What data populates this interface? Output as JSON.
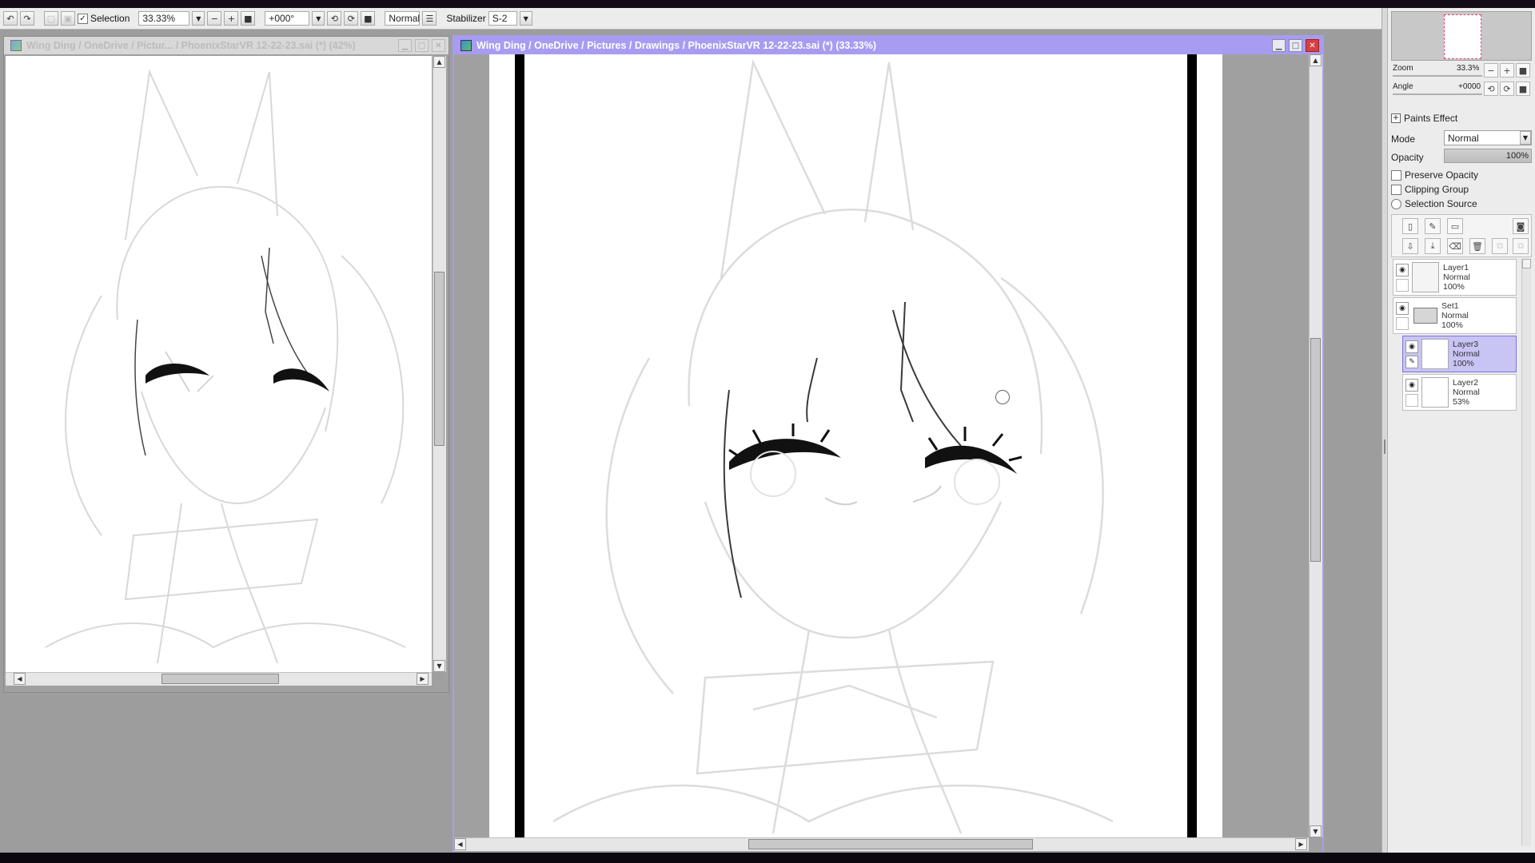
{
  "toolbar": {
    "selection_label": "Selection",
    "selection_checked": "✓",
    "zoom_value": "33.33%",
    "angle_value": "+000°",
    "blend_mode": "Normal",
    "stabilizer_label": "Stabilizer",
    "stabilizer_value": "S-2"
  },
  "windows": {
    "left": {
      "title": "Wing Ding / OneDrive / Pictur... / PhoenixStarVR 12-22-23.sai (*) (42%)"
    },
    "main": {
      "title": "Wing Ding / OneDrive / Pictures / Drawings / PhoenixStarVR 12-22-23.sai (*) (33.33%)"
    }
  },
  "navigator": {
    "zoom_label": "Zoom",
    "zoom_value": "33.3%",
    "angle_label": "Angle",
    "angle_value": "+0000"
  },
  "layer_props": {
    "paints_effect_label": "Paints Effect",
    "mode_label": "Mode",
    "mode_value": "Normal",
    "opacity_label": "Opacity",
    "opacity_value": "100%",
    "preserve_opacity_label": "Preserve Opacity",
    "clipping_group_label": "Clipping Group",
    "selection_source_label": "Selection Source"
  },
  "layers": [
    {
      "name": "Layer1",
      "mode": "Normal",
      "opacity": "100%"
    },
    {
      "name": "Set1",
      "mode": "Normal",
      "opacity": "100%"
    },
    {
      "name": "Layer3",
      "mode": "Normal",
      "opacity": "100%"
    },
    {
      "name": "Layer2",
      "mode": "Normal",
      "opacity": "53%"
    }
  ],
  "colors": {
    "active_title": "#a79cf2",
    "selected_layer": "#c8c4f4",
    "close_button": "#d64040"
  }
}
